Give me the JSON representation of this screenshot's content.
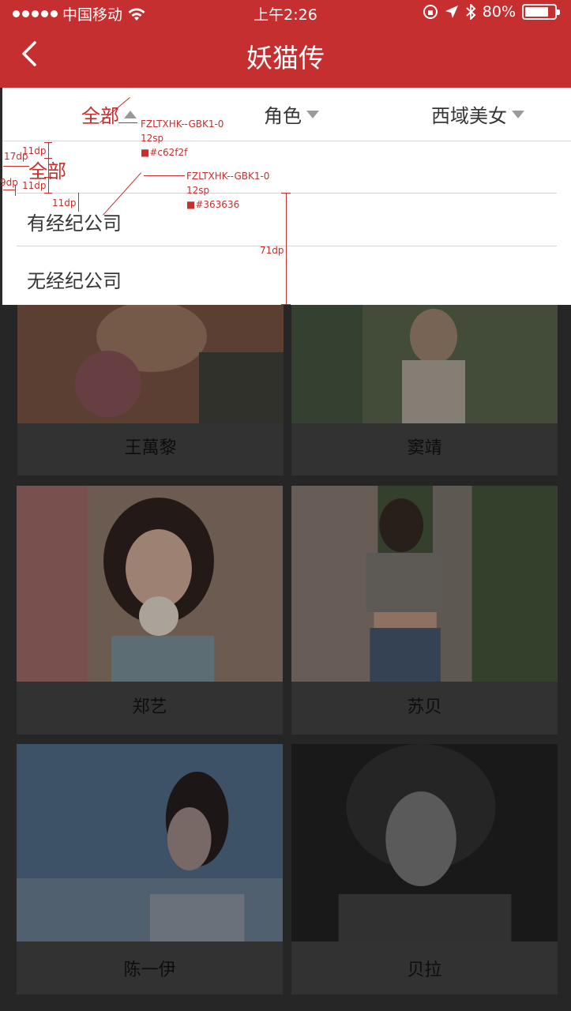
{
  "status_bar": {
    "carrier": "中国移动",
    "time": "上午2:26",
    "battery": "80%",
    "battery_level": 0.8
  },
  "nav": {
    "title": "妖猫传"
  },
  "filters": [
    {
      "label": "全部",
      "arrow": "up",
      "active": true
    },
    {
      "label": "角色",
      "arrow": "down",
      "active": false
    },
    {
      "label": "西域美女",
      "arrow": "down",
      "active": false
    }
  ],
  "dropdown": {
    "items": [
      {
        "label": "全部",
        "selected": true
      },
      {
        "label": "有经纪公司",
        "selected": false
      },
      {
        "label": "无经纪公司",
        "selected": false
      }
    ]
  },
  "annotations": {
    "font_a": "FZLTXHK--GBK1-0",
    "size_a": "12sp",
    "color_a": "#c62f2f",
    "font_b": "FZLTXHK--GBK1-0",
    "size_b": "12sp",
    "color_b": "#363636",
    "dim_11dp_top": "11dp",
    "dim_17dp": "17dp",
    "dim_11dp_bottom": "11dp",
    "dim_9dp": "9dp",
    "dim_11dp_gap": "11dp",
    "dim_71dp": "71dp"
  },
  "cards": [
    {
      "name": "王萬黎"
    },
    {
      "name": "窦靖"
    },
    {
      "name": "郑艺"
    },
    {
      "name": "苏贝"
    },
    {
      "name": "陈一伊"
    },
    {
      "name": "贝拉"
    }
  ],
  "colors": {
    "brand": "#c62f2f",
    "text": "#363636"
  }
}
